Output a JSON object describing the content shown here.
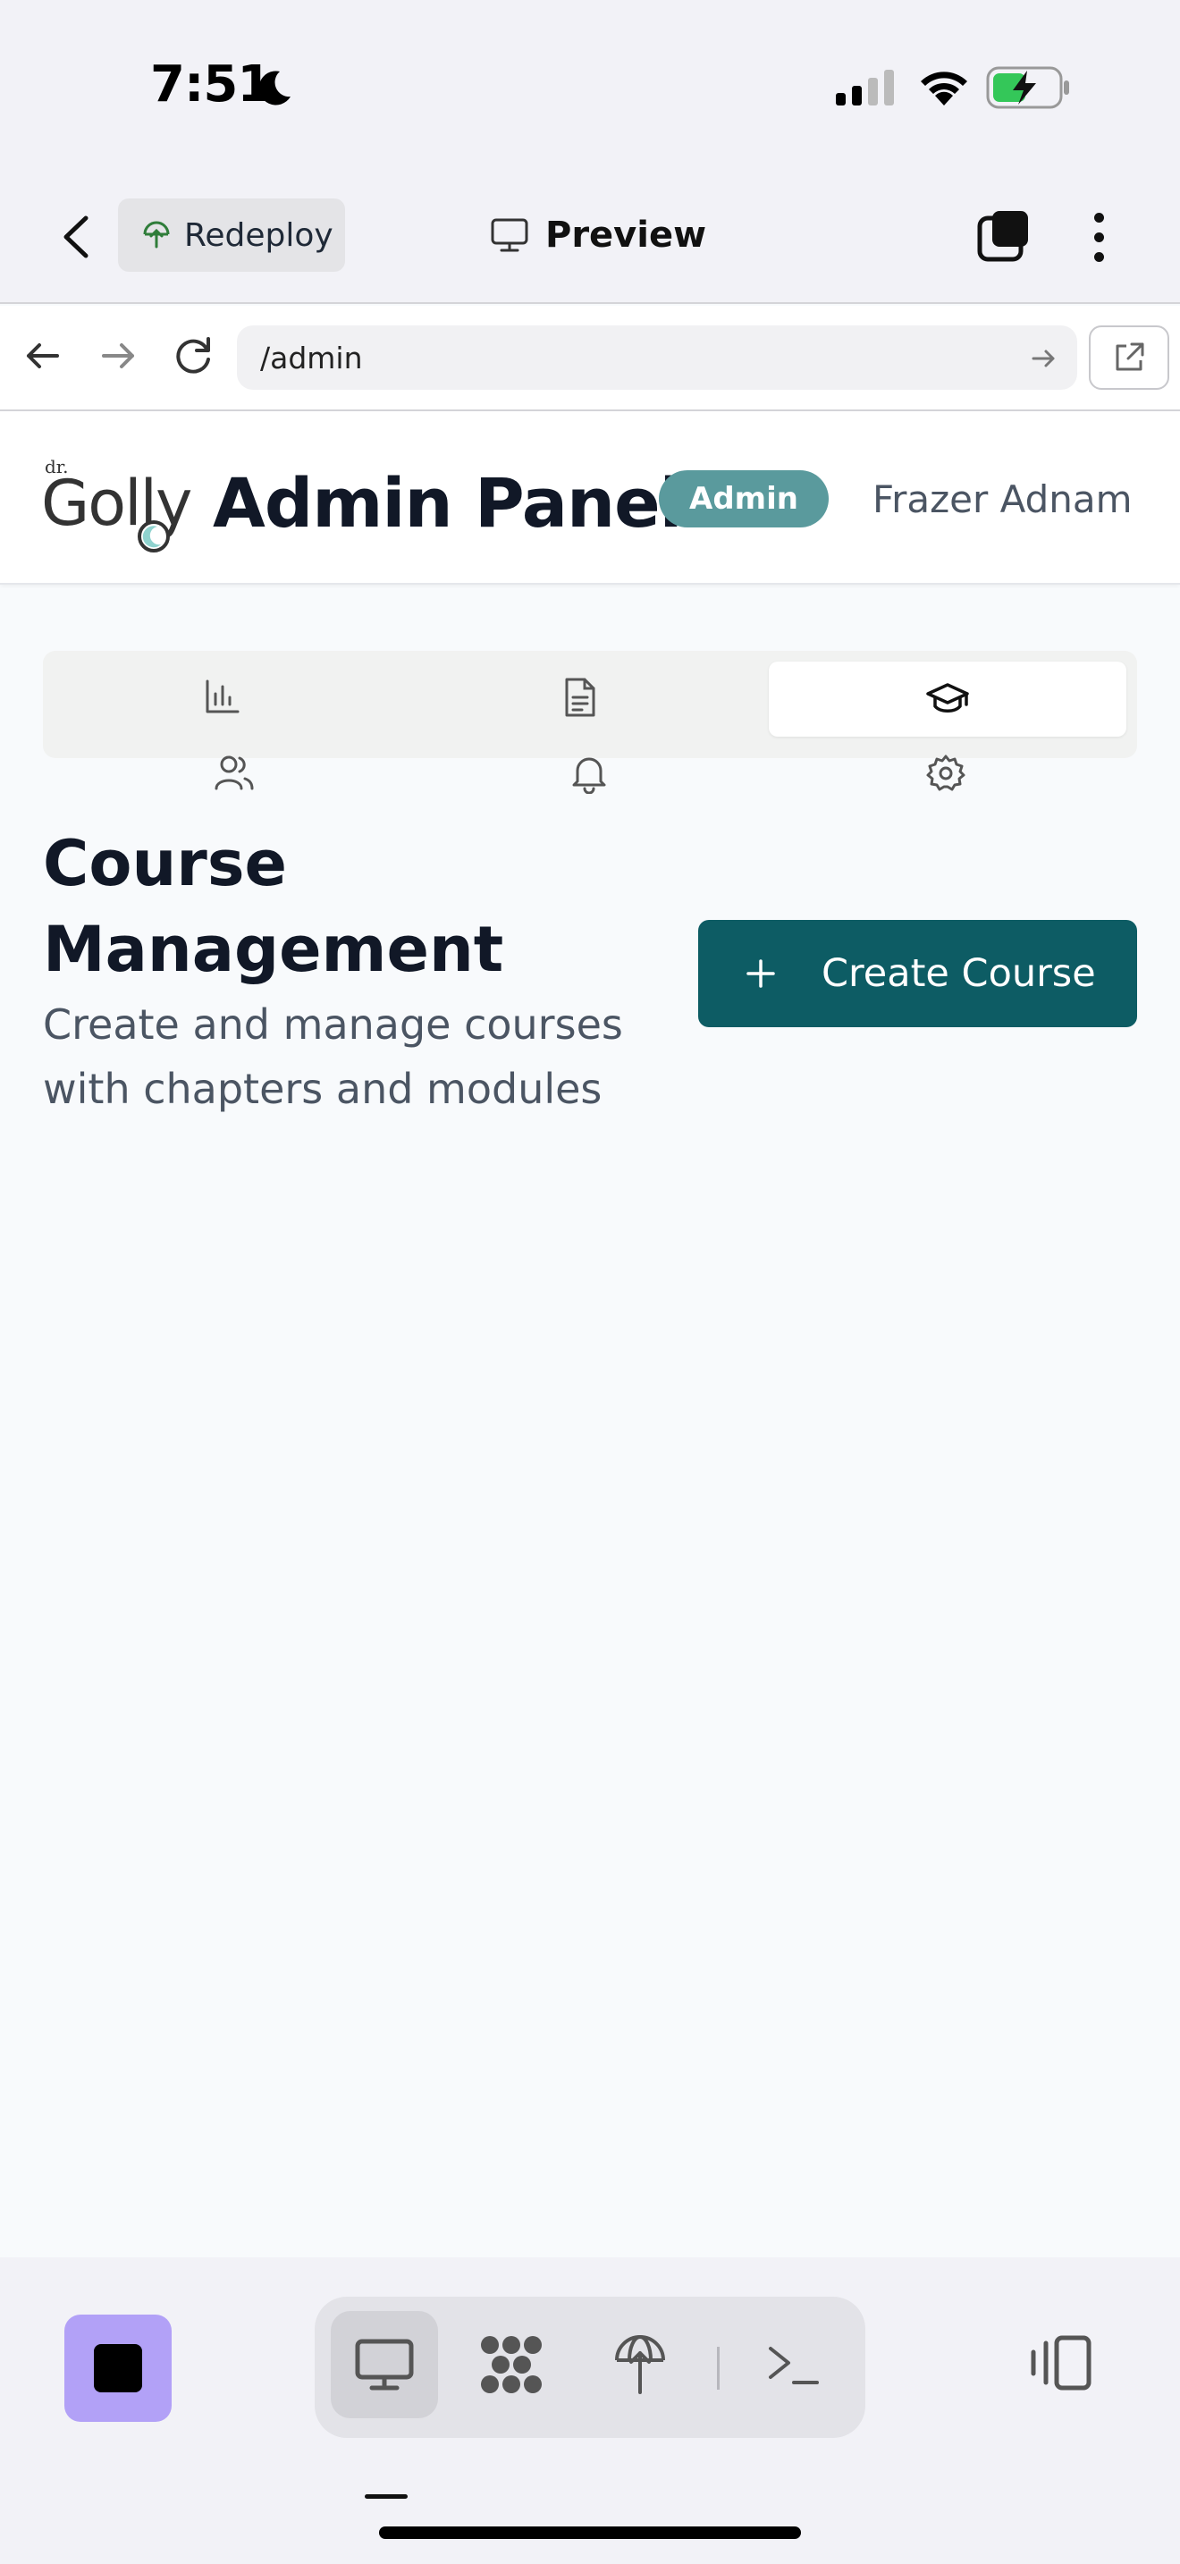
{
  "status_bar": {
    "time": "7:51"
  },
  "app_nav": {
    "redeploy_label": "Redeploy",
    "preview_label": "Preview"
  },
  "url_bar": {
    "value": "/admin"
  },
  "header": {
    "logo_text": "Golly",
    "logo_prefix": "dr.",
    "title": "Admin Panel",
    "badge": "Admin",
    "user_name": "Frazer Adnam"
  },
  "tabs": [
    {
      "id": "analytics",
      "icon": "bar-chart-icon",
      "active": false
    },
    {
      "id": "content",
      "icon": "document-icon",
      "active": false
    },
    {
      "id": "courses",
      "icon": "graduation-cap-icon",
      "active": true
    },
    {
      "id": "users",
      "icon": "users-icon",
      "active": false
    },
    {
      "id": "notifications",
      "icon": "bell-icon",
      "active": false
    },
    {
      "id": "settings",
      "icon": "gear-icon",
      "active": false
    }
  ],
  "main": {
    "title": "Course Management",
    "subtitle": "Create and manage courses with chapters and modules",
    "create_button_label": "Create Course"
  },
  "colors": {
    "primary": "#0d5c64",
    "badge": "#5a9a9d",
    "stop_button": "#b2a1f7",
    "battery_charge": "#34c759"
  }
}
